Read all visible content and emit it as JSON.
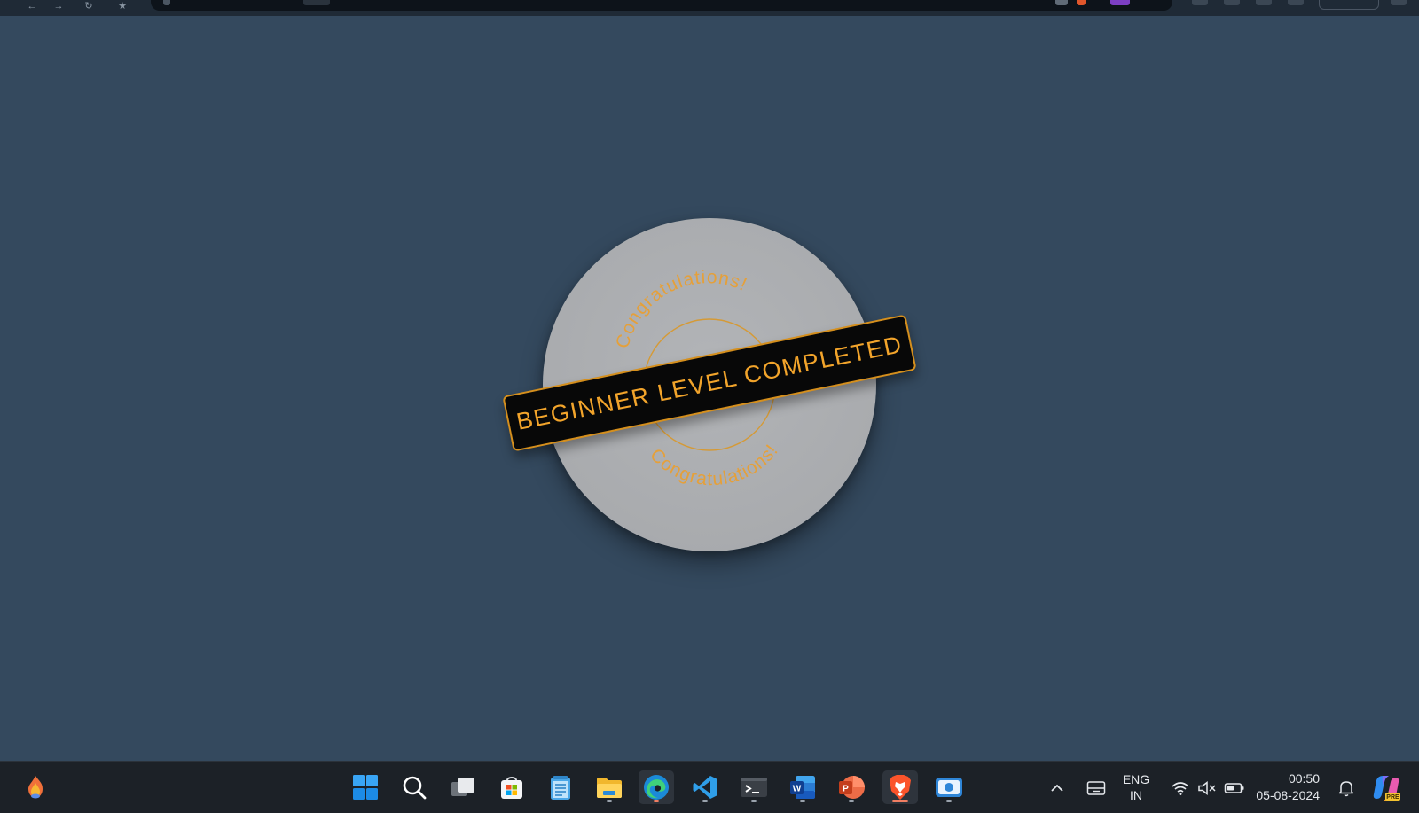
{
  "badge": {
    "ribbon_text": "BEGINNER LEVEL COMPLETED",
    "arc_text_top": "Congratulations!",
    "arc_text_bottom": "Congratulations!",
    "colors": {
      "page_background": "#34495e",
      "circle": "#aeb0b3",
      "ribbon_background": "#080808",
      "accent_gold": "#f2a42b"
    }
  },
  "taskbar": {
    "widget_icon": "flame-widget-icon",
    "pinned": [
      {
        "name": "start-icon"
      },
      {
        "name": "search-icon"
      },
      {
        "name": "task-view-icon"
      },
      {
        "name": "microsoft-store-icon"
      },
      {
        "name": "notepad-icon"
      },
      {
        "name": "file-explorer-icon"
      },
      {
        "name": "edge-icon"
      },
      {
        "name": "vscode-icon"
      },
      {
        "name": "terminal-icon"
      },
      {
        "name": "word-icon",
        "letter": "W"
      },
      {
        "name": "powerpoint-icon",
        "letter": "P"
      },
      {
        "name": "brave-icon"
      },
      {
        "name": "screen-recorder-icon"
      }
    ],
    "tray": {
      "language_line1": "ENG",
      "language_line2": "IN",
      "time": "00:50",
      "date": "05-08-2024",
      "copilot_badge": "PRE"
    }
  }
}
